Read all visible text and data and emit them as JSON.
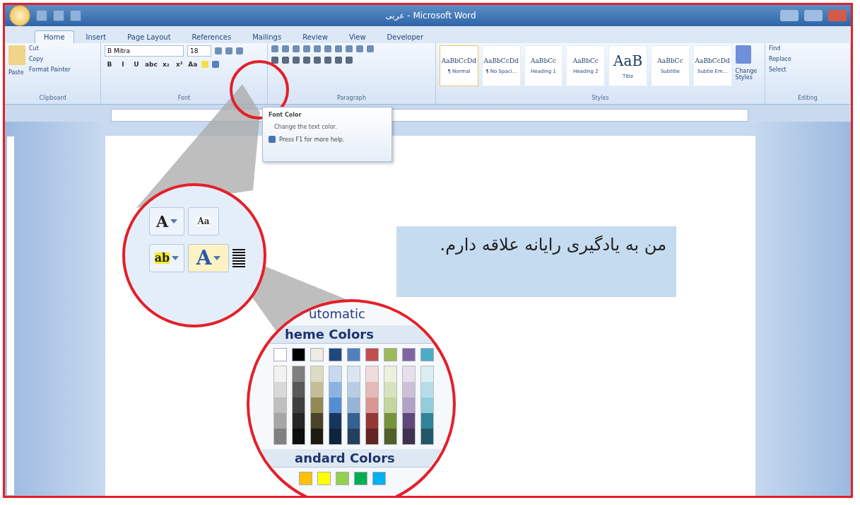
{
  "window": {
    "title": "عربی - Microsoft Word"
  },
  "tabs": [
    {
      "label": "Home",
      "selected": true
    },
    {
      "label": "Insert",
      "selected": false
    },
    {
      "label": "Page Layout",
      "selected": false
    },
    {
      "label": "References",
      "selected": false
    },
    {
      "label": "Mailings",
      "selected": false
    },
    {
      "label": "Review",
      "selected": false
    },
    {
      "label": "View",
      "selected": false
    },
    {
      "label": "Developer",
      "selected": false
    }
  ],
  "clipboard": {
    "paste": "Paste",
    "items": [
      "Cut",
      "Copy",
      "Format Painter"
    ],
    "label": "Clipboard"
  },
  "font": {
    "name": "B Mitra",
    "size": "18",
    "format_buttons": [
      "B",
      "I",
      "U",
      "abc",
      "x₂",
      "x²",
      "Aa"
    ],
    "label": "Font"
  },
  "paragraph": {
    "label": "Paragraph"
  },
  "styles": {
    "label": "Styles",
    "items": [
      {
        "preview": "AaBbCcDd",
        "name": "¶ Normal",
        "selected": true
      },
      {
        "preview": "AaBbCcDd",
        "name": "¶ No Spaci...",
        "selected": false
      },
      {
        "preview": "AaBbCc",
        "name": "Heading 1",
        "selected": false
      },
      {
        "preview": "AaBbCc",
        "name": "Heading 2",
        "selected": false
      },
      {
        "preview": "AaB",
        "name": "Title",
        "selected": false
      },
      {
        "preview": "AaBbCc",
        "name": "Subtitle",
        "selected": false
      },
      {
        "preview": "AaBbCcDd",
        "name": "Subtle Em...",
        "selected": false
      }
    ],
    "change_styles": "Change Styles"
  },
  "editing": {
    "items": [
      "Find",
      "Replace",
      "Select"
    ],
    "label": "Editing"
  },
  "tooltip": {
    "title": "Font Color",
    "description": "Change the text color.",
    "help": "Press F1 for more help."
  },
  "document": {
    "text": "من به یادگیری رایانه علاقه دارم."
  },
  "zoom_ribbon": {
    "grow_glyph": "A",
    "clear_glyph": "Aa",
    "highlight_glyph": "ab",
    "font_color_glyph": "A"
  },
  "zoom_palette": {
    "automatic": "utomatic",
    "theme_header": "heme Colors",
    "standard_header": "andard Colors",
    "theme_colors": [
      {
        "color": "#ffffff",
        "shades": [
          {
            "color": "#f2f2f2"
          },
          {
            "color": "#d9d9d9"
          },
          {
            "color": "#bfbfbf"
          },
          {
            "color": "#a6a6a6"
          },
          {
            "color": "#808080"
          }
        ]
      },
      {
        "color": "#000000",
        "shades": [
          {
            "color": "#7f7f7f"
          },
          {
            "color": "#595959"
          },
          {
            "color": "#3f3f3f"
          },
          {
            "color": "#262626"
          },
          {
            "color": "#0d0d0d"
          }
        ]
      },
      {
        "color": "#eeece1",
        "shades": [
          {
            "color": "#ddd9c3"
          },
          {
            "color": "#c4bd97"
          },
          {
            "color": "#938953"
          },
          {
            "color": "#494429"
          },
          {
            "color": "#1d1b10"
          }
        ]
      },
      {
        "color": "#1f497d",
        "shades": [
          {
            "color": "#c6d9f0"
          },
          {
            "color": "#8db3e2"
          },
          {
            "color": "#548dd4"
          },
          {
            "color": "#17365d"
          },
          {
            "color": "#0f243e"
          }
        ]
      },
      {
        "color": "#4f81bd",
        "shades": [
          {
            "color": "#dbe5f1"
          },
          {
            "color": "#b8cce4"
          },
          {
            "color": "#95b3d7"
          },
          {
            "color": "#366092"
          },
          {
            "color": "#244061"
          }
        ]
      },
      {
        "color": "#c0504d",
        "shades": [
          {
            "color": "#f2dcdb"
          },
          {
            "color": "#e5b9b7"
          },
          {
            "color": "#d99694"
          },
          {
            "color": "#953734"
          },
          {
            "color": "#632423"
          }
        ]
      },
      {
        "color": "#9bbb59",
        "shades": [
          {
            "color": "#ebf1dd"
          },
          {
            "color": "#d7e3bc"
          },
          {
            "color": "#c3d69b"
          },
          {
            "color": "#76923c"
          },
          {
            "color": "#4f6128"
          }
        ]
      },
      {
        "color": "#8064a2",
        "shades": [
          {
            "color": "#e5e0ec"
          },
          {
            "color": "#ccc1d9"
          },
          {
            "color": "#b2a2c7"
          },
          {
            "color": "#5f497a"
          },
          {
            "color": "#3f3151"
          }
        ]
      },
      {
        "color": "#4bacc6",
        "shades": [
          {
            "color": "#dbeef3"
          },
          {
            "color": "#b7dde8"
          },
          {
            "color": "#92cddc"
          },
          {
            "color": "#31859b"
          },
          {
            "color": "#205867"
          }
        ]
      }
    ],
    "standard_colors": [
      {
        "color": "#ffc000"
      },
      {
        "color": "#ffff00"
      },
      {
        "color": "#92d050"
      },
      {
        "color": "#00b050"
      },
      {
        "color": "#00b0f0"
      }
    ]
  }
}
